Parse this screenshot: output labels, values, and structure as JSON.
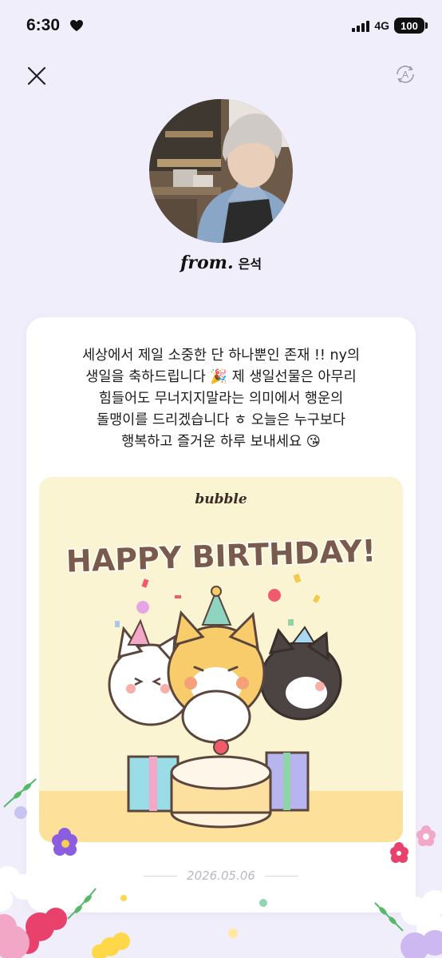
{
  "status_bar": {
    "time": "6:30",
    "network": "4G",
    "battery": "100"
  },
  "header": {
    "close_icon": "close-icon",
    "translate_icon": "translate-icon"
  },
  "sender": {
    "from_label": "from.",
    "name": "은석"
  },
  "letter": {
    "message": "세상에서 제일 소중한 단 하나뿐인 존재 !! ny의\n생일을 축하드립니다 🎉  제 생일선물은 아무리\n힘들어도 무너지지말라는 의미에서 행운의\n돌맹이를 드리겠습니다 ㅎ 오늘은 누구보다\n행복하고 즐거운 하루 보내세요 😘",
    "card": {
      "brand": "bubble",
      "headline": "HAPPY BIRTHDAY!"
    },
    "date": "2026.05.06"
  },
  "colors": {
    "background": "#f1eefb",
    "card_bg": "#fbf4d3",
    "headline": "#7a5a4b"
  }
}
